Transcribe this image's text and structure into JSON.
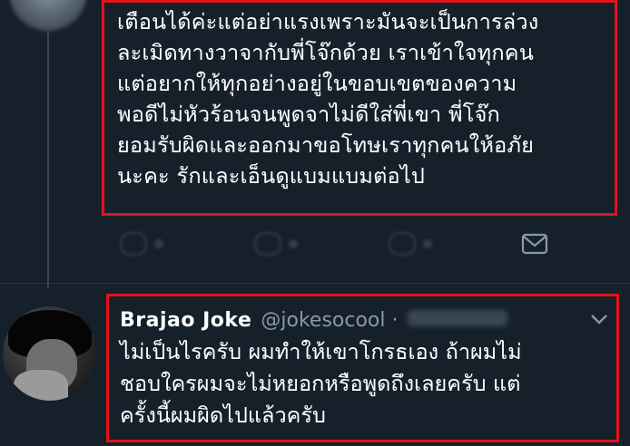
{
  "tweet1": {
    "lines": [
      "เตือนได้ค่ะแต่อย่าแรงเพราะมันจะเป็นการล่วง",
      "ละเมิดทางวาจากับพี่โจ๊กด้วย เราเข้าใจทุกคน",
      "แต่อยากให้ทุกอย่างอยู่ในขอบเขตของความ",
      "พอดีไม่หัวร้อนจนพูดจาไม่ดีใส่พี่เขา พี่โจ๊ก",
      "ยอมรับผิดและออกมาขอโทษเราทุกคนให้อภัย",
      "นะคะ รักและเอ็นดูแบมแบมต่อไป"
    ]
  },
  "actions": {
    "icons": [
      "reply-icon",
      "retweet-icon",
      "like-icon",
      "mail-icon"
    ]
  },
  "tweet2": {
    "display_name": "Brajao Joke",
    "handle": "@jokesocool ·",
    "lines": [
      "ไม่เป็นไรครับ ผมทำให้เขาโกรธเอง ถ้าผมไม่",
      "ชอบใครผมจะไม่หยอกหรือพูดถึงเลยครับ แต่",
      "ครั้งนี้ผมผิดไปแล้วครับ"
    ]
  },
  "colors": {
    "background": "#15202b",
    "highlight_border": "#e0141b",
    "secondary_text": "#8899a6"
  }
}
